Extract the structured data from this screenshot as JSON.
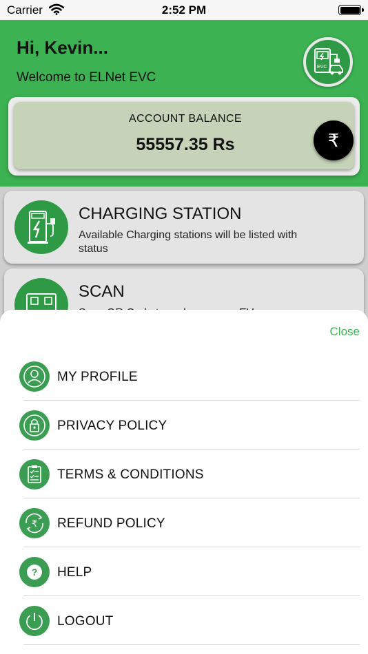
{
  "status_bar": {
    "carrier": "Carrier",
    "time": "2:52 PM"
  },
  "header": {
    "greeting": "Hi, Kevin...",
    "welcome": "Welcome to ELNet EVC",
    "logo_text": "EVC"
  },
  "balance": {
    "label": "ACCOUNT BALANCE",
    "amount": "55557.35 Rs",
    "currency_symbol": "₹"
  },
  "cards": [
    {
      "title": "CHARGING STATION",
      "description": "Available Charging stations will be listed with status",
      "icon": "charging-station-icon"
    },
    {
      "title": "SCAN",
      "description": "Scan QR Code to recharge your EV",
      "icon": "qr-scan-icon"
    }
  ],
  "sheet": {
    "close_label": "Close",
    "items": [
      {
        "label": "MY PROFILE",
        "icon": "user-icon"
      },
      {
        "label": "PRIVACY POLICY",
        "icon": "privacy-icon"
      },
      {
        "label": "TERMS & CONDITIONS",
        "icon": "clipboard-icon"
      },
      {
        "label": "REFUND POLICY",
        "icon": "refund-icon"
      },
      {
        "label": "HELP",
        "icon": "help-icon"
      },
      {
        "label": "LOGOUT",
        "icon": "power-icon"
      }
    ]
  },
  "colors": {
    "primary_green": "#3cb252",
    "dark_green": "#2f9a46",
    "balance_card": "#c6d3b8"
  }
}
